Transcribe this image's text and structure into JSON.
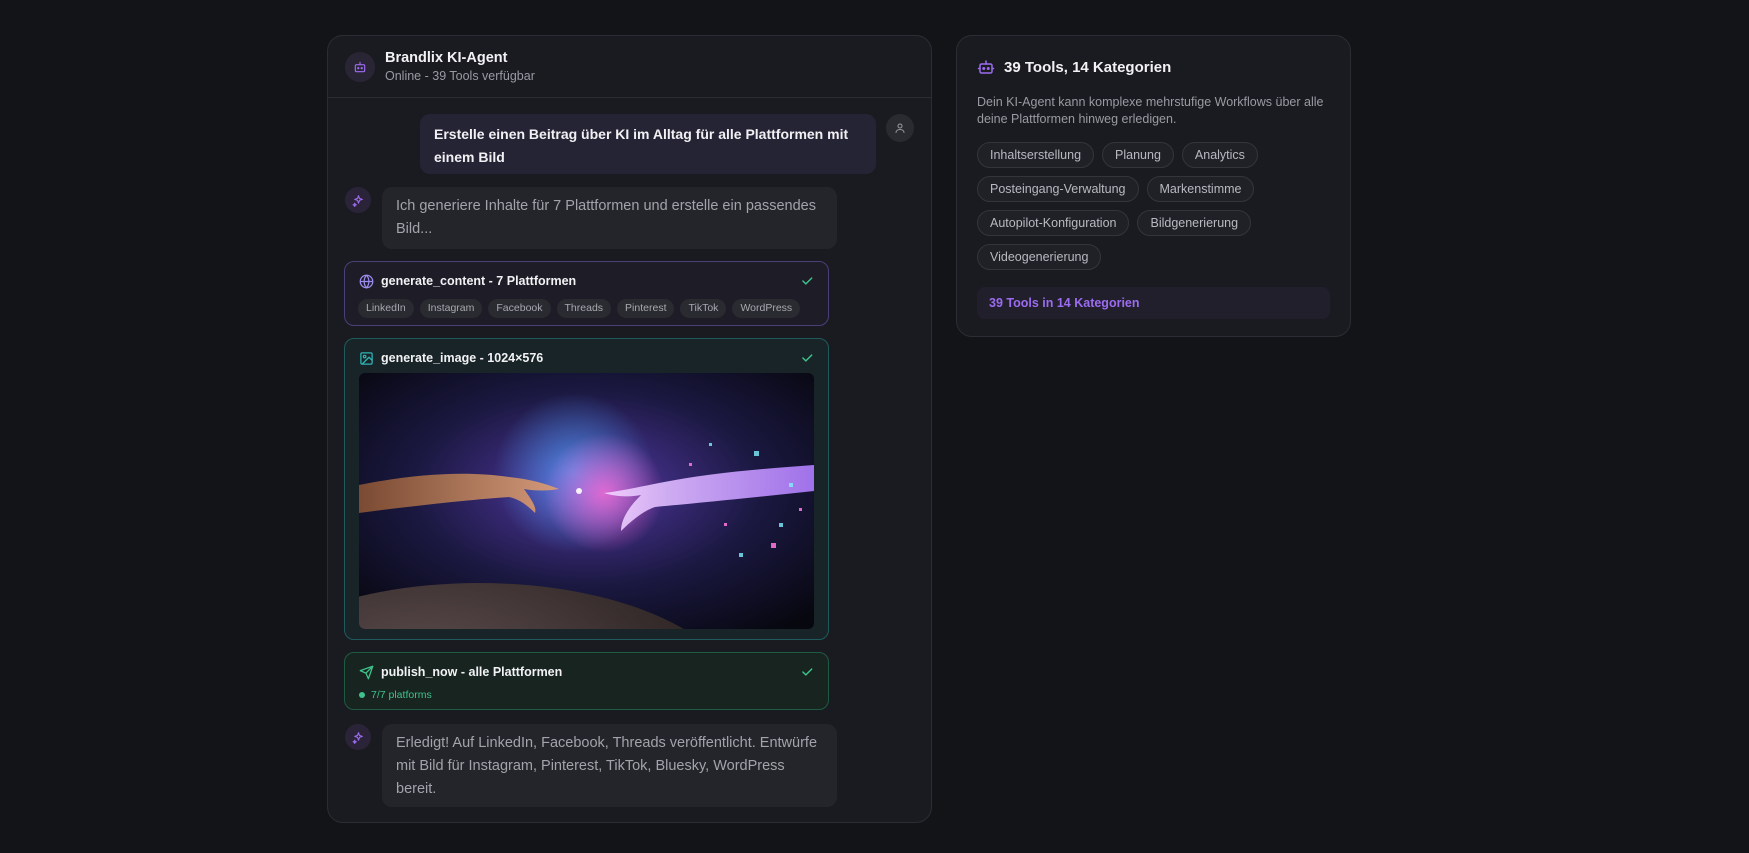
{
  "agent": {
    "name": "Brandlix KI-Agent",
    "status": "Online - 39 Tools verfügbar"
  },
  "messages": {
    "user": "Erstelle einen Beitrag über KI im Alltag für alle Plattformen mit einem Bild",
    "ai_intro": "Ich generiere Inhalte für 7 Plattformen und erstelle ein passendes Bild...",
    "ai_done": "Erledigt! Auf LinkedIn, Facebook, Threads veröffentlicht. Entwürfe mit Bild für Instagram, Pinterest, TikTok, Bluesky, WordPress bereit."
  },
  "tools": {
    "content": {
      "title": "generate_content - 7 Plattformen",
      "icon": "globe-icon",
      "platforms": [
        "LinkedIn",
        "Instagram",
        "Facebook",
        "Threads",
        "Pinterest",
        "TikTok",
        "WordPress"
      ]
    },
    "image": {
      "title": "generate_image - 1024×576",
      "icon": "image-icon"
    },
    "publish": {
      "title": "publish_now - alle Plattformen",
      "icon": "send-icon",
      "status": "7/7 platforms"
    }
  },
  "info": {
    "title": "39 Tools, 14 Kategorien",
    "description": "Dein KI-Agent kann komplexe mehrstufige Workflows über alle deine Plattformen hinweg erledigen.",
    "categories": [
      "Inhaltserstellung",
      "Planung",
      "Analytics",
      "Posteingang-Verwaltung",
      "Markenstimme",
      "Autopilot-Konfiguration",
      "Bildgenerierung",
      "Videogenerierung"
    ],
    "footer": "39 Tools in 14 Kategorien"
  },
  "colors": {
    "accent": "#9b6cf0",
    "success": "#3fc28c",
    "teal": "#2fb3b5"
  }
}
